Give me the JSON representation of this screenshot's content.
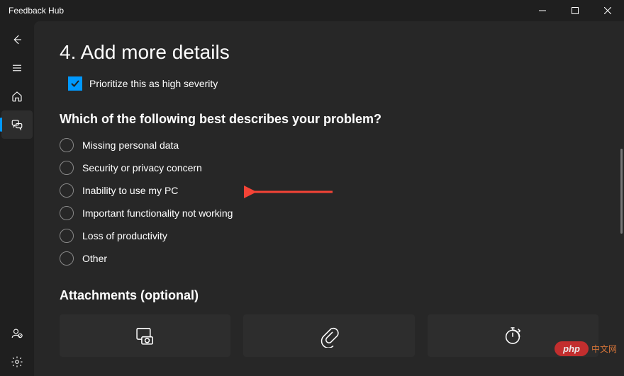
{
  "window": {
    "title": "Feedback Hub"
  },
  "section": {
    "title": "4. Add more details",
    "prioritize_label": "Prioritize this as high severity",
    "prioritize_checked": true
  },
  "question": {
    "title": "Which of the following best describes your problem?",
    "options": [
      "Missing personal data",
      "Security or privacy concern",
      "Inability to use my PC",
      "Important functionality not working",
      "Loss of productivity",
      "Other"
    ]
  },
  "attachments": {
    "title": "Attachments (optional)"
  },
  "sidebar": {
    "items": [
      "back",
      "menu",
      "home",
      "feedback",
      "profile",
      "settings"
    ]
  },
  "watermark": {
    "badge": "php",
    "text": "中文网"
  },
  "colors": {
    "accent": "#0099ff",
    "bg_main": "#272727",
    "bg_outer": "#1f1f1f",
    "card": "#2d2d2d",
    "arrow": "#f44336"
  }
}
